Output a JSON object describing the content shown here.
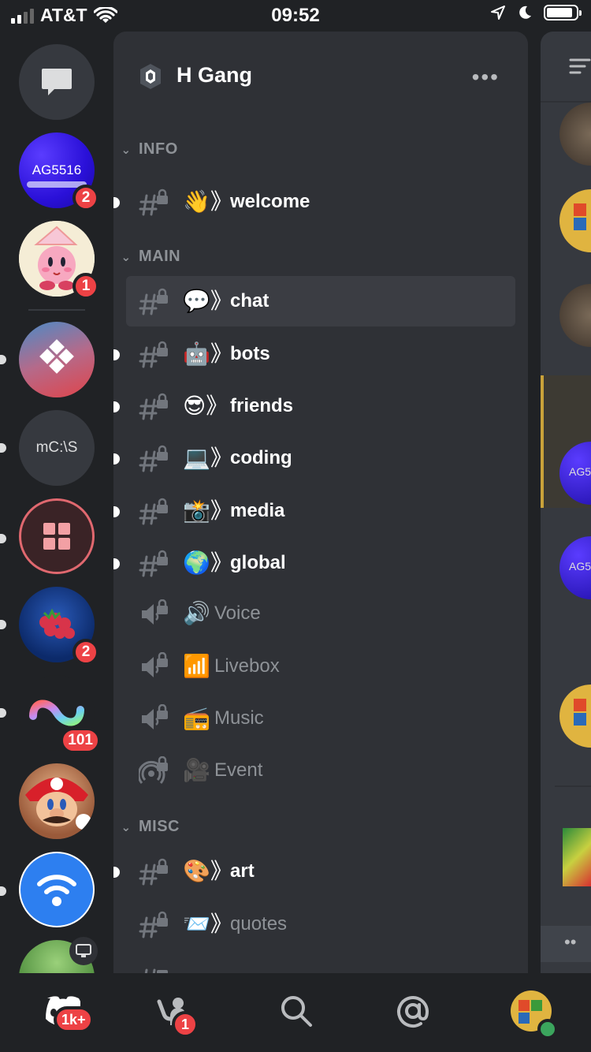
{
  "status_bar": {
    "carrier": "AT&T",
    "time": "09:52"
  },
  "servers": [
    {
      "id": "dm",
      "label": "",
      "icon": "chat-bubble-icon",
      "badge": ""
    },
    {
      "id": "ag5516",
      "label": "AG5516",
      "icon": "",
      "badge": "2"
    },
    {
      "id": "kirby",
      "label": "",
      "icon": "kirby-avatar",
      "badge": "1"
    },
    {
      "id": "sunset",
      "label": "",
      "icon": "diamond-logo",
      "badge": ""
    },
    {
      "id": "mcs",
      "label": "mC:\\S",
      "icon": "",
      "badge": ""
    },
    {
      "id": "windows",
      "label": "",
      "icon": "windows-logo",
      "badge": ""
    },
    {
      "id": "raspberry",
      "label": "",
      "icon": "raspberry-avatar",
      "badge": "2"
    },
    {
      "id": "loop",
      "label": "",
      "icon": "infinity-logo",
      "badge": "101"
    },
    {
      "id": "mario",
      "label": "",
      "icon": "mario-avatar",
      "badge": ""
    },
    {
      "id": "wifi",
      "label": "",
      "icon": "wifi-logo",
      "badge": ""
    }
  ],
  "guild": {
    "name": "H Gang",
    "more_label": "•••"
  },
  "categories": {
    "info": "INFO",
    "main": "MAIN",
    "misc": "MISC"
  },
  "channels": {
    "welcome": {
      "emoji": "👋》",
      "name": "welcome"
    },
    "chat": {
      "emoji": "💬》",
      "name": "chat"
    },
    "bots": {
      "emoji": "🤖》",
      "name": "bots"
    },
    "friends": {
      "emoji": "😎》",
      "name": "friends"
    },
    "coding": {
      "emoji": "💻》",
      "name": "coding"
    },
    "media": {
      "emoji": "📸》",
      "name": "media"
    },
    "global": {
      "emoji": "🌍》",
      "name": "global"
    },
    "voice": {
      "emoji": "🔊",
      "name": "Voice"
    },
    "livebox": {
      "emoji": "📶",
      "name": "Livebox"
    },
    "music": {
      "emoji": "📻",
      "name": "Music"
    },
    "event": {
      "emoji": "🎥",
      "name": "Event"
    },
    "art": {
      "emoji": "🎨》",
      "name": "art"
    },
    "quotes": {
      "emoji": "📨》",
      "name": "quotes"
    }
  },
  "rightpane": {
    "partial_text_1": "AG5",
    "partial_text_2": "AG5"
  },
  "tabbar": {
    "home_badge": "1k+",
    "friends_badge": "1"
  },
  "colors": {
    "accent": "#5865f2",
    "badge": "#ed4245",
    "background": "#202225",
    "panel": "#2f3136"
  }
}
